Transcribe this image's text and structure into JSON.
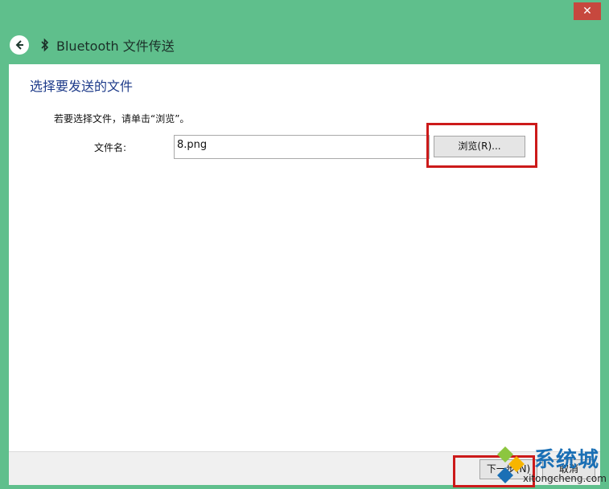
{
  "window": {
    "close_glyph": "✕"
  },
  "header": {
    "title": "Bluetooth 文件传送"
  },
  "page": {
    "heading": "选择要发送的文件",
    "instruction": "若要选择文件，请单击“浏览”。",
    "file_label": "文件名:",
    "file_value": "8.png",
    "browse_label": "浏览(R)..."
  },
  "footer": {
    "next_label": "下一步(N)",
    "cancel_label": "取消"
  },
  "watermark": {
    "name": "系统城",
    "url": "xitongcheng.com"
  },
  "colors": {
    "window_bg": "#5fbf8c",
    "close_bg": "#c7483e",
    "heading": "#1e3b8a",
    "highlight": "#cc1a1a",
    "watermark": "#1a6fb5"
  }
}
